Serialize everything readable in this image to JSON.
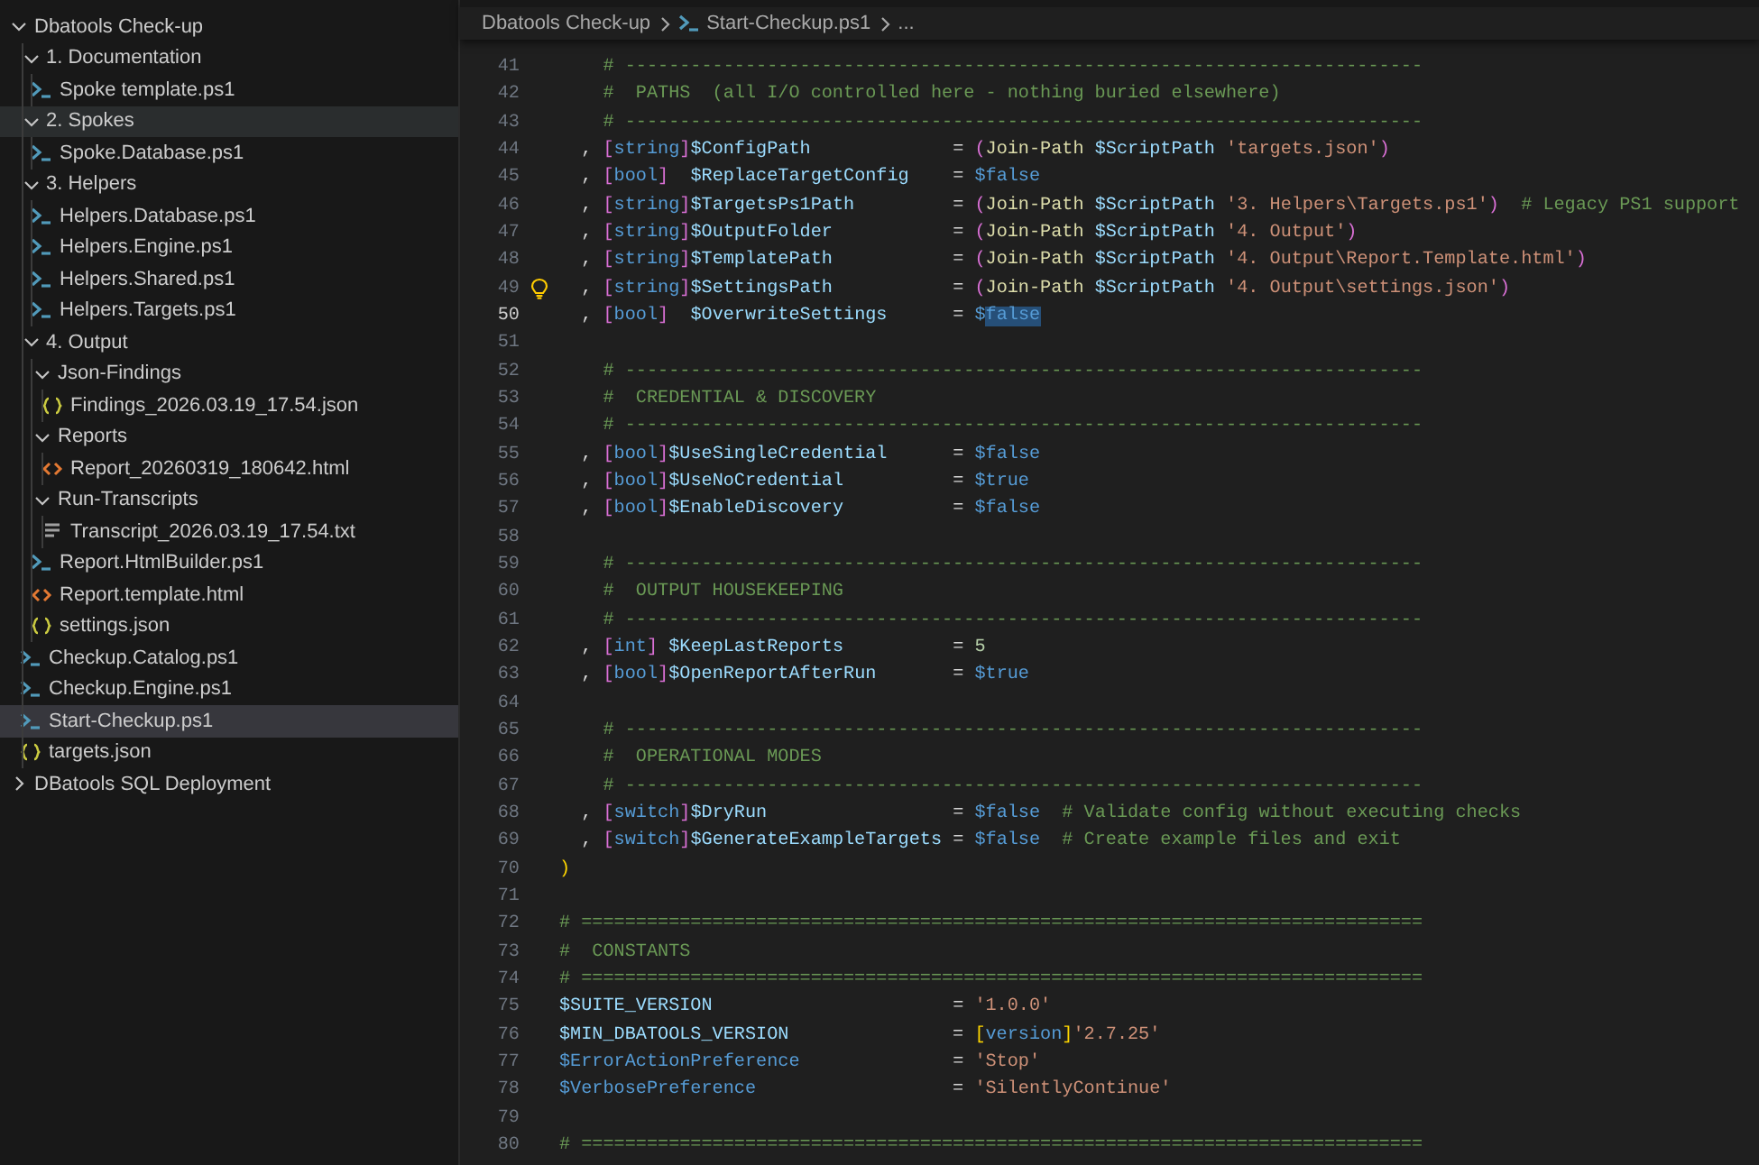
{
  "explorer": {
    "tree": [
      {
        "kind": "folder",
        "label": "Dbatools Check-up",
        "expanded": true,
        "selected": false,
        "hovered": false,
        "children": [
          {
            "kind": "folder",
            "label": "1. Documentation",
            "expanded": true,
            "selected": false,
            "hovered": false,
            "children": [
              {
                "kind": "ps1",
                "label": "Spoke template.ps1",
                "selected": false,
                "hovered": false
              }
            ]
          },
          {
            "kind": "folder",
            "label": "2. Spokes",
            "expanded": true,
            "selected": false,
            "hovered": true,
            "children": [
              {
                "kind": "ps1",
                "label": "Spoke.Database.ps1",
                "selected": false,
                "hovered": false
              }
            ]
          },
          {
            "kind": "folder",
            "label": "3. Helpers",
            "expanded": true,
            "selected": false,
            "hovered": false,
            "children": [
              {
                "kind": "ps1",
                "label": "Helpers.Database.ps1",
                "selected": false,
                "hovered": false
              },
              {
                "kind": "ps1",
                "label": "Helpers.Engine.ps1",
                "selected": false,
                "hovered": false
              },
              {
                "kind": "ps1",
                "label": "Helpers.Shared.ps1",
                "selected": false,
                "hovered": false
              },
              {
                "kind": "ps1",
                "label": "Helpers.Targets.ps1",
                "selected": false,
                "hovered": false
              }
            ]
          },
          {
            "kind": "folder",
            "label": "4. Output",
            "expanded": true,
            "selected": false,
            "hovered": false,
            "children": [
              {
                "kind": "folder",
                "label": "Json-Findings",
                "expanded": true,
                "selected": false,
                "hovered": false,
                "children": [
                  {
                    "kind": "json",
                    "label": "Findings_2026.03.19_17.54.json",
                    "selected": false,
                    "hovered": false
                  }
                ]
              },
              {
                "kind": "folder",
                "label": "Reports",
                "expanded": true,
                "selected": false,
                "hovered": false,
                "children": [
                  {
                    "kind": "html",
                    "label": "Report_20260319_180642.html",
                    "selected": false,
                    "hovered": false
                  }
                ]
              },
              {
                "kind": "folder",
                "label": "Run-Transcripts",
                "expanded": true,
                "selected": false,
                "hovered": false,
                "children": [
                  {
                    "kind": "txt",
                    "label": "Transcript_2026.03.19_17.54.txt",
                    "selected": false,
                    "hovered": false
                  }
                ]
              },
              {
                "kind": "ps1",
                "label": "Report.HtmlBuilder.ps1",
                "selected": false,
                "hovered": false
              },
              {
                "kind": "html",
                "label": "Report.template.html",
                "selected": false,
                "hovered": false
              },
              {
                "kind": "json",
                "label": "settings.json",
                "selected": false,
                "hovered": false
              }
            ]
          },
          {
            "kind": "ps1",
            "label": "Checkup.Catalog.ps1",
            "selected": false,
            "hovered": false
          },
          {
            "kind": "ps1",
            "label": "Checkup.Engine.ps1",
            "selected": false,
            "hovered": false
          },
          {
            "kind": "ps1",
            "label": "Start-Checkup.ps1",
            "selected": true,
            "hovered": false
          },
          {
            "kind": "json",
            "label": "targets.json",
            "selected": false,
            "hovered": false
          }
        ]
      },
      {
        "kind": "folder",
        "label": "DBatools SQL Deployment",
        "expanded": false,
        "selected": false,
        "hovered": false
      }
    ]
  },
  "breadcrumbs": [
    {
      "kind": "folder",
      "label": "Dbatools Check-up"
    },
    {
      "kind": "ps1",
      "label": "Start-Checkup.ps1"
    },
    {
      "kind": "more",
      "label": "..."
    }
  ],
  "editor": {
    "lines": [
      {
        "number": "41",
        "current": false,
        "tokens": [
          {
            "kind": "c",
            "text": "    # -------------------------------------------------------------------------"
          }
        ]
      },
      {
        "number": "42",
        "current": false,
        "tokens": [
          {
            "kind": "c",
            "text": "    #  PATHS  (all I/O controlled here - nothing buried elsewhere)"
          }
        ]
      },
      {
        "number": "43",
        "current": false,
        "tokens": [
          {
            "kind": "c",
            "text": "    # -------------------------------------------------------------------------"
          }
        ]
      },
      {
        "number": "44",
        "current": false,
        "tokens": [
          {
            "kind": "p",
            "text": "  , "
          },
          {
            "kind": "b",
            "text": "["
          },
          {
            "kind": "t",
            "text": "string"
          },
          {
            "kind": "b",
            "text": "]"
          },
          {
            "kind": "v",
            "text": "$ConfigPath"
          },
          {
            "kind": "p",
            "text": "             = "
          },
          {
            "kind": "b",
            "text": "("
          },
          {
            "kind": "f",
            "text": "Join-Path "
          },
          {
            "kind": "v",
            "text": "$ScriptPath "
          },
          {
            "kind": "s",
            "text": "'targets.json'"
          },
          {
            "kind": "b",
            "text": ")"
          }
        ]
      },
      {
        "number": "45",
        "current": false,
        "tokens": [
          {
            "kind": "p",
            "text": "  , "
          },
          {
            "kind": "b",
            "text": "["
          },
          {
            "kind": "t",
            "text": "bool"
          },
          {
            "kind": "b",
            "text": "]"
          },
          {
            "kind": "v",
            "text": "  $ReplaceTargetConfig"
          },
          {
            "kind": "p",
            "text": "    = "
          },
          {
            "kind": "a",
            "text": "$false"
          }
        ]
      },
      {
        "number": "46",
        "current": false,
        "tokens": [
          {
            "kind": "p",
            "text": "  , "
          },
          {
            "kind": "b",
            "text": "["
          },
          {
            "kind": "t",
            "text": "string"
          },
          {
            "kind": "b",
            "text": "]"
          },
          {
            "kind": "v",
            "text": "$TargetsPs1Path"
          },
          {
            "kind": "p",
            "text": "         = "
          },
          {
            "kind": "b",
            "text": "("
          },
          {
            "kind": "f",
            "text": "Join-Path "
          },
          {
            "kind": "v",
            "text": "$ScriptPath "
          },
          {
            "kind": "s",
            "text": "'3. Helpers\\Targets.ps1'"
          },
          {
            "kind": "b",
            "text": ")"
          },
          {
            "kind": "c",
            "text": "  # Legacy PS1 support"
          }
        ]
      },
      {
        "number": "47",
        "current": false,
        "tokens": [
          {
            "kind": "p",
            "text": "  , "
          },
          {
            "kind": "b",
            "text": "["
          },
          {
            "kind": "t",
            "text": "string"
          },
          {
            "kind": "b",
            "text": "]"
          },
          {
            "kind": "v",
            "text": "$OutputFolder"
          },
          {
            "kind": "p",
            "text": "           = "
          },
          {
            "kind": "b",
            "text": "("
          },
          {
            "kind": "f",
            "text": "Join-Path "
          },
          {
            "kind": "v",
            "text": "$ScriptPath "
          },
          {
            "kind": "s",
            "text": "'4. Output'"
          },
          {
            "kind": "b",
            "text": ")"
          }
        ]
      },
      {
        "number": "48",
        "current": false,
        "tokens": [
          {
            "kind": "p",
            "text": "  , "
          },
          {
            "kind": "b",
            "text": "["
          },
          {
            "kind": "t",
            "text": "string"
          },
          {
            "kind": "b",
            "text": "]"
          },
          {
            "kind": "v",
            "text": "$TemplatePath"
          },
          {
            "kind": "p",
            "text": "           = "
          },
          {
            "kind": "b",
            "text": "("
          },
          {
            "kind": "f",
            "text": "Join-Path "
          },
          {
            "kind": "v",
            "text": "$ScriptPath "
          },
          {
            "kind": "s",
            "text": "'4. Output\\Report.Template.html'"
          },
          {
            "kind": "b",
            "text": ")"
          }
        ]
      },
      {
        "number": "49",
        "current": false,
        "hint": true,
        "tokens": [
          {
            "kind": "p",
            "text": "  , "
          },
          {
            "kind": "b",
            "text": "["
          },
          {
            "kind": "t",
            "text": "string"
          },
          {
            "kind": "b",
            "text": "]"
          },
          {
            "kind": "v",
            "text": "$SettingsPath"
          },
          {
            "kind": "p",
            "text": "           = "
          },
          {
            "kind": "b",
            "text": "("
          },
          {
            "kind": "f",
            "text": "Join-Path "
          },
          {
            "kind": "v",
            "text": "$ScriptPath "
          },
          {
            "kind": "s",
            "text": "'4. Output\\settings.json'"
          },
          {
            "kind": "b",
            "text": ")"
          }
        ]
      },
      {
        "number": "50",
        "current": true,
        "tokens": [
          {
            "kind": "p",
            "text": "  , "
          },
          {
            "kind": "b",
            "text": "["
          },
          {
            "kind": "t",
            "text": "bool"
          },
          {
            "kind": "b",
            "text": "]"
          },
          {
            "kind": "v",
            "text": "  $OverwriteSettings"
          },
          {
            "kind": "p",
            "text": "      = "
          },
          {
            "kind": "a",
            "text": "$"
          },
          {
            "kind": "sel",
            "text": "false"
          }
        ]
      },
      {
        "number": "51",
        "current": false
      },
      {
        "number": "52",
        "current": false,
        "tokens": [
          {
            "kind": "c",
            "text": "    # -------------------------------------------------------------------------"
          }
        ]
      },
      {
        "number": "53",
        "current": false,
        "tokens": [
          {
            "kind": "c",
            "text": "    #  CREDENTIAL & DISCOVERY"
          }
        ]
      },
      {
        "number": "54",
        "current": false,
        "tokens": [
          {
            "kind": "c",
            "text": "    # -------------------------------------------------------------------------"
          }
        ]
      },
      {
        "number": "55",
        "current": false,
        "tokens": [
          {
            "kind": "p",
            "text": "  , "
          },
          {
            "kind": "b",
            "text": "["
          },
          {
            "kind": "t",
            "text": "bool"
          },
          {
            "kind": "b",
            "text": "]"
          },
          {
            "kind": "v",
            "text": "$UseSingleCredential"
          },
          {
            "kind": "p",
            "text": "      = "
          },
          {
            "kind": "a",
            "text": "$false"
          }
        ]
      },
      {
        "number": "56",
        "current": false,
        "tokens": [
          {
            "kind": "p",
            "text": "  , "
          },
          {
            "kind": "b",
            "text": "["
          },
          {
            "kind": "t",
            "text": "bool"
          },
          {
            "kind": "b",
            "text": "]"
          },
          {
            "kind": "v",
            "text": "$UseNoCredential"
          },
          {
            "kind": "p",
            "text": "          = "
          },
          {
            "kind": "a",
            "text": "$true"
          }
        ]
      },
      {
        "number": "57",
        "current": false,
        "tokens": [
          {
            "kind": "p",
            "text": "  , "
          },
          {
            "kind": "b",
            "text": "["
          },
          {
            "kind": "t",
            "text": "bool"
          },
          {
            "kind": "b",
            "text": "]"
          },
          {
            "kind": "v",
            "text": "$EnableDiscovery"
          },
          {
            "kind": "p",
            "text": "          = "
          },
          {
            "kind": "a",
            "text": "$false"
          }
        ]
      },
      {
        "number": "58",
        "current": false
      },
      {
        "number": "59",
        "current": false,
        "tokens": [
          {
            "kind": "c",
            "text": "    # -------------------------------------------------------------------------"
          }
        ]
      },
      {
        "number": "60",
        "current": false,
        "tokens": [
          {
            "kind": "c",
            "text": "    #  OUTPUT HOUSEKEEPING"
          }
        ]
      },
      {
        "number": "61",
        "current": false,
        "tokens": [
          {
            "kind": "c",
            "text": "    # -------------------------------------------------------------------------"
          }
        ]
      },
      {
        "number": "62",
        "current": false,
        "tokens": [
          {
            "kind": "p",
            "text": "  , "
          },
          {
            "kind": "b",
            "text": "["
          },
          {
            "kind": "t",
            "text": "int"
          },
          {
            "kind": "b",
            "text": "]"
          },
          {
            "kind": "v",
            "text": " $KeepLastReports"
          },
          {
            "kind": "p",
            "text": "          = "
          },
          {
            "kind": "n",
            "text": "5"
          }
        ]
      },
      {
        "number": "63",
        "current": false,
        "tokens": [
          {
            "kind": "p",
            "text": "  , "
          },
          {
            "kind": "b",
            "text": "["
          },
          {
            "kind": "t",
            "text": "bool"
          },
          {
            "kind": "b",
            "text": "]"
          },
          {
            "kind": "v",
            "text": "$OpenReportAfterRun"
          },
          {
            "kind": "p",
            "text": "       = "
          },
          {
            "kind": "a",
            "text": "$true"
          }
        ]
      },
      {
        "number": "64",
        "current": false
      },
      {
        "number": "65",
        "current": false,
        "tokens": [
          {
            "kind": "c",
            "text": "    # -------------------------------------------------------------------------"
          }
        ]
      },
      {
        "number": "66",
        "current": false,
        "tokens": [
          {
            "kind": "c",
            "text": "    #  OPERATIONAL MODES"
          }
        ]
      },
      {
        "number": "67",
        "current": false,
        "tokens": [
          {
            "kind": "c",
            "text": "    # -------------------------------------------------------------------------"
          }
        ]
      },
      {
        "number": "68",
        "current": false,
        "tokens": [
          {
            "kind": "p",
            "text": "  , "
          },
          {
            "kind": "b",
            "text": "["
          },
          {
            "kind": "t",
            "text": "switch"
          },
          {
            "kind": "b",
            "text": "]"
          },
          {
            "kind": "v",
            "text": "$DryRun"
          },
          {
            "kind": "p",
            "text": "                 = "
          },
          {
            "kind": "a",
            "text": "$false"
          },
          {
            "kind": "c",
            "text": "  # Validate config without executing checks"
          }
        ]
      },
      {
        "number": "69",
        "current": false,
        "tokens": [
          {
            "kind": "p",
            "text": "  , "
          },
          {
            "kind": "b",
            "text": "["
          },
          {
            "kind": "t",
            "text": "switch"
          },
          {
            "kind": "b",
            "text": "]"
          },
          {
            "kind": "v",
            "text": "$GenerateExampleTargets"
          },
          {
            "kind": "p",
            "text": " = "
          },
          {
            "kind": "a",
            "text": "$false"
          },
          {
            "kind": "c",
            "text": "  # Create example files and exit"
          }
        ]
      },
      {
        "number": "70",
        "current": false,
        "tokens": [
          {
            "kind": "y",
            "text": ")"
          }
        ]
      },
      {
        "number": "71",
        "current": false
      },
      {
        "number": "72",
        "current": false,
        "tokens": [
          {
            "kind": "c",
            "text": "# ============================================================================="
          }
        ]
      },
      {
        "number": "73",
        "current": false,
        "tokens": [
          {
            "kind": "c",
            "text": "#  CONSTANTS"
          }
        ]
      },
      {
        "number": "74",
        "current": false,
        "tokens": [
          {
            "kind": "c",
            "text": "# ============================================================================="
          }
        ]
      },
      {
        "number": "75",
        "current": false,
        "tokens": [
          {
            "kind": "v",
            "text": "$SUITE_VERSION"
          },
          {
            "kind": "p",
            "text": "                      = "
          },
          {
            "kind": "s",
            "text": "'1.0.0'"
          }
        ]
      },
      {
        "number": "76",
        "current": false,
        "tokens": [
          {
            "kind": "v",
            "text": "$MIN_DBATOOLS_VERSION"
          },
          {
            "kind": "p",
            "text": "               = "
          },
          {
            "kind": "y",
            "text": "["
          },
          {
            "kind": "t",
            "text": "version"
          },
          {
            "kind": "y",
            "text": "]"
          },
          {
            "kind": "s",
            "text": "'2.7.25'"
          }
        ]
      },
      {
        "number": "77",
        "current": false,
        "tokens": [
          {
            "kind": "a",
            "text": "$ErrorActionPreference"
          },
          {
            "kind": "p",
            "text": "              = "
          },
          {
            "kind": "s",
            "text": "'Stop'"
          }
        ]
      },
      {
        "number": "78",
        "current": false,
        "tokens": [
          {
            "kind": "a",
            "text": "$VerbosePreference"
          },
          {
            "kind": "p",
            "text": "                  = "
          },
          {
            "kind": "s",
            "text": "'SilentlyContinue'"
          }
        ]
      },
      {
        "number": "79",
        "current": false
      },
      {
        "number": "80",
        "current": false,
        "tokens": [
          {
            "kind": "c",
            "text": "# ============================================================================="
          }
        ]
      }
    ]
  }
}
